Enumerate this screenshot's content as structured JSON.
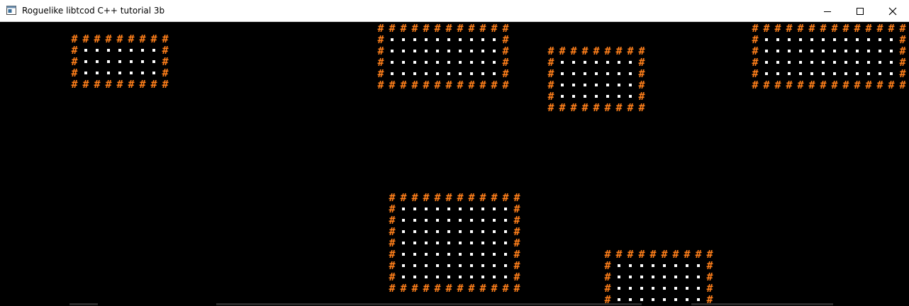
{
  "window": {
    "title": "Roguelike libtcod C++ tutorial 3b",
    "controls": {
      "minimize": "minimize-icon",
      "maximize": "maximize-icon",
      "close": "close-icon"
    }
  },
  "console": {
    "wall_glyph": "#",
    "floor_glyph": "·",
    "colors": {
      "background": "#000000",
      "wall": "#ff7f1a",
      "floor": "#ffffff"
    }
  }
}
